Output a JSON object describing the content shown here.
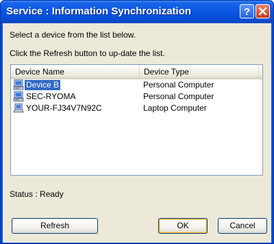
{
  "window": {
    "title": "Service : Information Synchronization"
  },
  "instructions": {
    "line1": "Select a device from the list below.",
    "line2": "Click the Refresh button to up-date the list."
  },
  "device_list": {
    "columns": [
      "Device Name",
      "Device Type"
    ],
    "rows": [
      {
        "name": "Device B",
        "type": "Personal Computer",
        "icon": "personal-computer-icon",
        "selected": true
      },
      {
        "name": "SEC-RYOMA",
        "type": "Personal Computer",
        "icon": "personal-computer-icon",
        "selected": false
      },
      {
        "name": "YOUR-FJ34V7N92C",
        "type": "Laptop Computer",
        "icon": "laptop-computer-icon",
        "selected": false
      }
    ]
  },
  "status": {
    "text": "Status : Ready"
  },
  "buttons": {
    "refresh": "Refresh",
    "ok": "OK",
    "cancel": "Cancel"
  },
  "colors": {
    "titlebar": "#0a57e3",
    "selection": "#316ac5",
    "dialog_bg": "#ece9d8"
  }
}
